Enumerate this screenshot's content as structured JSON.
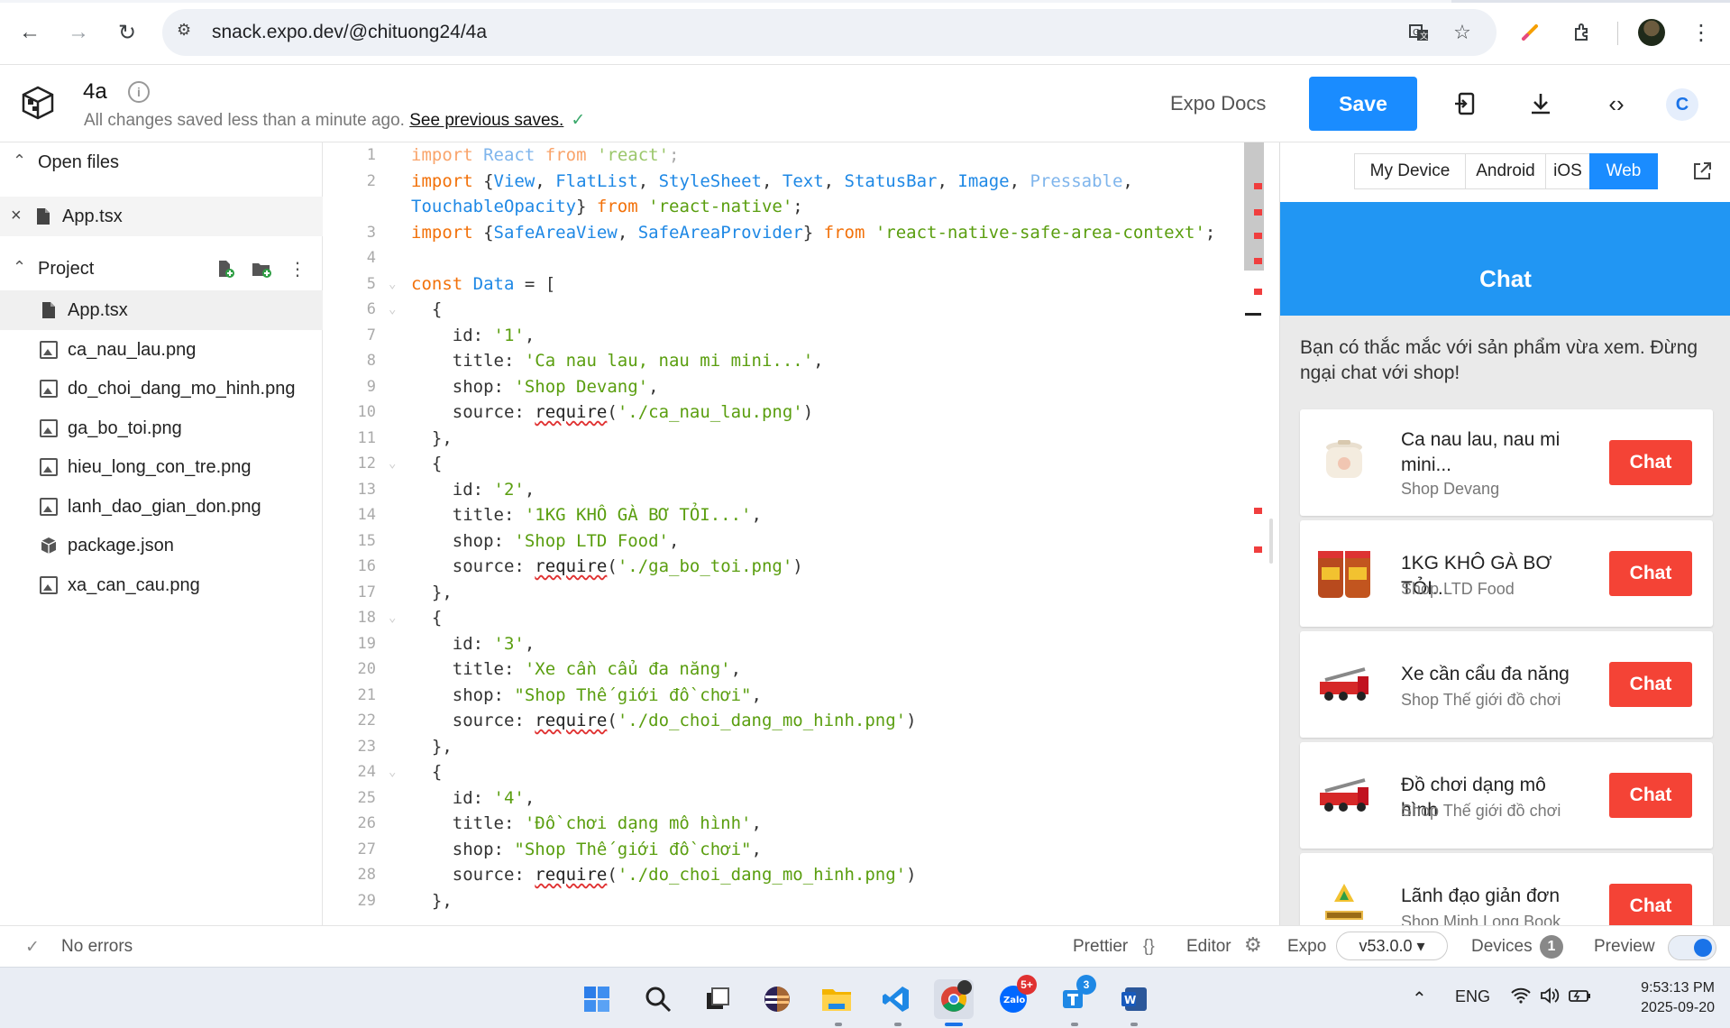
{
  "browser": {
    "url": "snack.expo.dev/@chituong24/4a"
  },
  "header": {
    "project_name": "4a",
    "save_status": "All changes saved less than a minute ago.",
    "see_previous": "See previous saves.",
    "expo_docs": "Expo Docs",
    "save_label": "Save",
    "avatar_letter": "C"
  },
  "sidebar": {
    "open_files_label": "Open files",
    "open_files": [
      {
        "name": "App.tsx",
        "icon": "code-file-icon"
      }
    ],
    "project_label": "Project",
    "project_files": [
      {
        "name": "App.tsx",
        "icon": "code-file-icon"
      },
      {
        "name": "ca_nau_lau.png",
        "icon": "image-file-icon"
      },
      {
        "name": "do_choi_dang_mo_hinh.png",
        "icon": "image-file-icon"
      },
      {
        "name": "ga_bo_toi.png",
        "icon": "image-file-icon"
      },
      {
        "name": "hieu_long_con_tre.png",
        "icon": "image-file-icon"
      },
      {
        "name": "lanh_dao_gian_don.png",
        "icon": "image-file-icon"
      },
      {
        "name": "package.json",
        "icon": "package-icon"
      },
      {
        "name": "xa_can_cau.png",
        "icon": "image-file-icon"
      }
    ]
  },
  "editor": {
    "lines": [
      {
        "n": "1",
        "faded": true,
        "tokens": [
          [
            "kw",
            "import"
          ],
          [
            "pl",
            " "
          ],
          [
            "id",
            "React"
          ],
          [
            "pl",
            " "
          ],
          [
            "kw",
            "from"
          ],
          [
            "pl",
            " "
          ],
          [
            "str",
            "'react'"
          ],
          [
            "pl",
            ";"
          ]
        ]
      },
      {
        "n": "2",
        "tokens": [
          [
            "kw",
            "import"
          ],
          [
            "pl",
            " {"
          ],
          [
            "id",
            "View"
          ],
          [
            "pl",
            ", "
          ],
          [
            "id",
            "FlatList"
          ],
          [
            "pl",
            ", "
          ],
          [
            "id",
            "StyleSheet"
          ],
          [
            "pl",
            ", "
          ],
          [
            "id",
            "Text"
          ],
          [
            "pl",
            ", "
          ],
          [
            "id",
            "StatusBar"
          ],
          [
            "pl",
            ", "
          ],
          [
            "id",
            "Image"
          ],
          [
            "pl",
            ", "
          ],
          [
            "idf",
            "Pressable"
          ],
          [
            "pl",
            ","
          ]
        ]
      },
      {
        "n": "",
        "tokens": [
          [
            "id",
            "TouchableOpacity"
          ],
          [
            "pl",
            "} "
          ],
          [
            "kw",
            "from"
          ],
          [
            "pl",
            " "
          ],
          [
            "str",
            "'react-native'"
          ],
          [
            "pl",
            ";"
          ]
        ]
      },
      {
        "n": "3",
        "tokens": [
          [
            "kw",
            "import"
          ],
          [
            "pl",
            " {"
          ],
          [
            "id",
            "SafeAreaView"
          ],
          [
            "pl",
            ", "
          ],
          [
            "id",
            "SafeAreaProvider"
          ],
          [
            "pl",
            "} "
          ],
          [
            "kw",
            "from"
          ],
          [
            "pl",
            " "
          ],
          [
            "str",
            "'react-native-safe-area-context'"
          ],
          [
            "pl",
            ";"
          ]
        ]
      },
      {
        "n": "4",
        "tokens": []
      },
      {
        "n": "5",
        "fold": true,
        "tokens": [
          [
            "kw",
            "const"
          ],
          [
            "pl",
            " "
          ],
          [
            "id",
            "Data"
          ],
          [
            "pl",
            " = ["
          ]
        ]
      },
      {
        "n": "6",
        "fold": true,
        "tokens": [
          [
            "pl",
            "  {"
          ]
        ]
      },
      {
        "n": "7",
        "tokens": [
          [
            "pl",
            "    id: "
          ],
          [
            "str",
            "'1'"
          ],
          [
            "pl",
            ","
          ]
        ]
      },
      {
        "n": "8",
        "tokens": [
          [
            "pl",
            "    title: "
          ],
          [
            "str",
            "'Ca nau lau, nau mi mini...'"
          ],
          [
            "pl",
            ","
          ]
        ]
      },
      {
        "n": "9",
        "tokens": [
          [
            "pl",
            "    shop: "
          ],
          [
            "str",
            "'Shop Devang'"
          ],
          [
            "pl",
            ","
          ]
        ]
      },
      {
        "n": "10",
        "tokens": [
          [
            "pl",
            "    source: "
          ],
          [
            "req",
            "require"
          ],
          [
            "pl",
            "("
          ],
          [
            "str",
            "'./ca_nau_lau.png'"
          ],
          [
            "pl",
            ")"
          ]
        ]
      },
      {
        "n": "11",
        "tokens": [
          [
            "pl",
            "  },"
          ]
        ]
      },
      {
        "n": "12",
        "fold": true,
        "tokens": [
          [
            "pl",
            "  {"
          ]
        ]
      },
      {
        "n": "13",
        "tokens": [
          [
            "pl",
            "    id: "
          ],
          [
            "str",
            "'2'"
          ],
          [
            "pl",
            ","
          ]
        ]
      },
      {
        "n": "14",
        "tokens": [
          [
            "pl",
            "    title: "
          ],
          [
            "str",
            "'1KG KHÔ GÀ BƠ TỎI...'"
          ],
          [
            "pl",
            ","
          ]
        ]
      },
      {
        "n": "15",
        "tokens": [
          [
            "pl",
            "    shop: "
          ],
          [
            "str",
            "'Shop LTD Food'"
          ],
          [
            "pl",
            ","
          ]
        ]
      },
      {
        "n": "16",
        "tokens": [
          [
            "pl",
            "    source: "
          ],
          [
            "req",
            "require"
          ],
          [
            "pl",
            "("
          ],
          [
            "str",
            "'./ga_bo_toi.png'"
          ],
          [
            "pl",
            ")"
          ]
        ]
      },
      {
        "n": "17",
        "tokens": [
          [
            "pl",
            "  },"
          ]
        ]
      },
      {
        "n": "18",
        "fold": true,
        "tokens": [
          [
            "pl",
            "  {"
          ]
        ]
      },
      {
        "n": "19",
        "tokens": [
          [
            "pl",
            "    id: "
          ],
          [
            "str",
            "'3'"
          ],
          [
            "pl",
            ","
          ]
        ]
      },
      {
        "n": "20",
        "tokens": [
          [
            "pl",
            "    title: "
          ],
          [
            "str",
            "'Xe cần cẩu đa năng'"
          ],
          [
            "pl",
            ","
          ]
        ]
      },
      {
        "n": "21",
        "tokens": [
          [
            "pl",
            "    shop: "
          ],
          [
            "str",
            "\"Shop Thế giới đồ chơi\""
          ],
          [
            "pl",
            ","
          ]
        ]
      },
      {
        "n": "22",
        "tokens": [
          [
            "pl",
            "    source: "
          ],
          [
            "req",
            "require"
          ],
          [
            "pl",
            "("
          ],
          [
            "str",
            "'./do_choi_dang_mo_hinh.png'"
          ],
          [
            "pl",
            ")"
          ]
        ]
      },
      {
        "n": "23",
        "tokens": [
          [
            "pl",
            "  },"
          ]
        ]
      },
      {
        "n": "24",
        "fold": true,
        "tokens": [
          [
            "pl",
            "  {"
          ]
        ]
      },
      {
        "n": "25",
        "tokens": [
          [
            "pl",
            "    id: "
          ],
          [
            "str",
            "'4'"
          ],
          [
            "pl",
            ","
          ]
        ]
      },
      {
        "n": "26",
        "tokens": [
          [
            "pl",
            "    title: "
          ],
          [
            "str",
            "'Đồ chơi dạng mô hình'"
          ],
          [
            "pl",
            ","
          ]
        ]
      },
      {
        "n": "27",
        "tokens": [
          [
            "pl",
            "    shop: "
          ],
          [
            "str",
            "\"Shop Thế giới đồ chơi\""
          ],
          [
            "pl",
            ","
          ]
        ]
      },
      {
        "n": "28",
        "tokens": [
          [
            "pl",
            "    source: "
          ],
          [
            "req",
            "require"
          ],
          [
            "pl",
            "("
          ],
          [
            "str",
            "'./do_choi_dang_mo_hinh.png'"
          ],
          [
            "pl",
            ")"
          ]
        ]
      },
      {
        "n": "29",
        "tokens": [
          [
            "pl",
            "  },"
          ]
        ]
      }
    ]
  },
  "preview": {
    "tabs": [
      {
        "label": "My Device",
        "active": false
      },
      {
        "label": "Android",
        "active": false
      },
      {
        "label": "iOS",
        "active": false
      },
      {
        "label": "Web",
        "active": true
      }
    ],
    "app_title": "Chat",
    "intro": "Bạn có thắc mắc với sản phẩm vừa xem. Đừng ngại chat với shop!",
    "items": [
      {
        "title": "Ca nau lau, nau mi mini...",
        "shop": "Shop Devang",
        "button": "Chat",
        "thumb": "pot-image"
      },
      {
        "title": "1KG KHÔ GÀ BƠ TỎI...",
        "shop": "Shop LTD Food",
        "button": "Chat",
        "thumb": "jars-image"
      },
      {
        "title": "Xe cần cẩu đa năng",
        "shop": "Shop Thế giới đồ chơi",
        "button": "Chat",
        "thumb": "truck-image"
      },
      {
        "title": "Đồ chơi dạng mô hình",
        "shop": "Shop Thế giới đồ chơi",
        "button": "Chat",
        "thumb": "truck-image"
      },
      {
        "title": "Lãnh đạo giản đơn",
        "shop": "Shop Minh Long Book",
        "button": "Chat",
        "thumb": "book-image"
      }
    ]
  },
  "footer": {
    "errors": "No errors",
    "prettier": "Prettier",
    "editor": "Editor",
    "expo": "Expo",
    "version": "v53.0.0 ▾",
    "devices": "Devices",
    "devices_count": "1",
    "preview": "Preview"
  },
  "taskbar": {
    "zalo_badge": "5+",
    "task_badge": "3",
    "lang": "ENG",
    "time": "9:53:13 PM",
    "date": "2025-09-20"
  },
  "colors": {
    "accent": "#1a8cff",
    "app_header": "#2196f3",
    "chat_button": "#f44336"
  }
}
